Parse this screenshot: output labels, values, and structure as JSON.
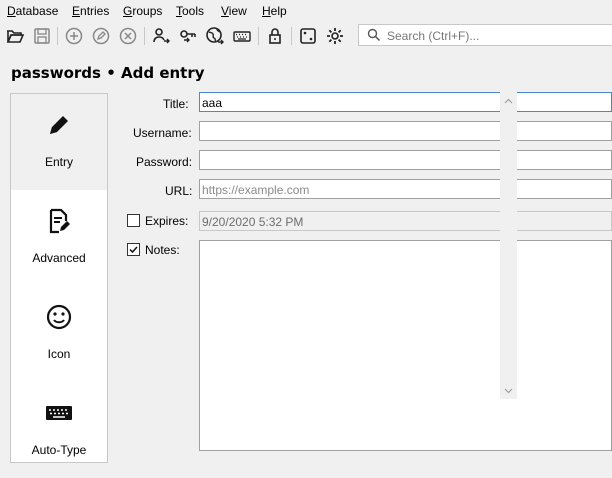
{
  "menu": [
    {
      "mnemonic": "D",
      "rest": "atabase"
    },
    {
      "mnemonic": "E",
      "rest": "ntries"
    },
    {
      "mnemonic": "G",
      "rest": "roups"
    },
    {
      "mnemonic": "T",
      "rest": "ools"
    },
    {
      "mnemonic": "V",
      "rest": "iew"
    },
    {
      "mnemonic": "H",
      "rest": "elp"
    }
  ],
  "toolbar": {
    "icons": [
      "open-database-icon",
      "save-database-icon",
      "add-entry-icon",
      "edit-entry-icon",
      "delete-entry-icon",
      "copy-username-icon",
      "copy-password-icon",
      "open-url-icon",
      "autotype-icon",
      "lock-database-icon",
      "password-generator-icon",
      "settings-icon"
    ]
  },
  "search": {
    "placeholder": "Search (Ctrl+F)..."
  },
  "page": {
    "database": "passwords",
    "separator": "•",
    "action": "Add entry"
  },
  "categories": [
    {
      "label": "Entry",
      "icon": "pencil-icon"
    },
    {
      "label": "Advanced",
      "icon": "document-edit-icon"
    },
    {
      "label": "Icon",
      "icon": "smiley-icon"
    },
    {
      "label": "Auto-Type",
      "icon": "keyboard-icon"
    }
  ],
  "form": {
    "title_label": "Title:",
    "title_value": "aaa",
    "username_label": "Username:",
    "username_value": "",
    "password_label": "Password:",
    "password_value": "",
    "url_label": "URL:",
    "url_placeholder": "https://example.com",
    "expires_label": "Expires:",
    "expires_checked": false,
    "expires_value": "9/20/2020 5:32 PM",
    "notes_label": "Notes:",
    "notes_checked": true,
    "notes_value": ""
  },
  "colors": {
    "focus_border": "#4a88c7",
    "background": "#f0f0f0"
  }
}
